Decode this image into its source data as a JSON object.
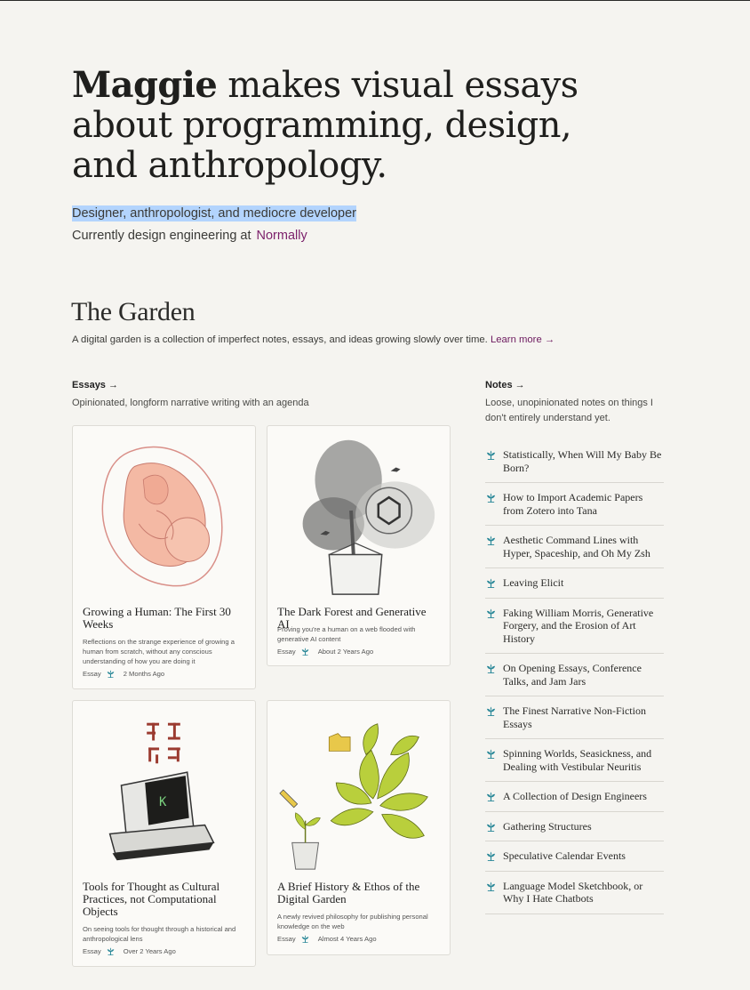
{
  "hero": {
    "name": "Maggie",
    "title_rest": " makes visual essays about programming, design, and anthropology.",
    "subtitle_highlighted": "Designer, anthropologist, and mediocre developer",
    "current_prefix": "Currently design engineering at",
    "current_link": "Normally"
  },
  "garden": {
    "title": "The Garden",
    "description": "A digital garden is a collection of imperfect notes, essays, and ideas growing slowly over time.",
    "learn_more": "Learn more →"
  },
  "essays": {
    "heading": "Essays",
    "arrow": "→",
    "description": "Opinionated, longform narrative writing with an agenda",
    "items": [
      {
        "title": "Growing a Human: The First 30 Weeks",
        "description": "Reflections on the strange experience of growing a human from scratch, without any conscious understanding of how you are doing it",
        "type": "Essay",
        "date": "2 Months Ago"
      },
      {
        "title": "The Dark Forest and Generative AI",
        "description": "Proving you're a human on a web flooded with generative AI content",
        "type": "Essay",
        "date": "About 2 Years Ago"
      },
      {
        "title": "Tools for Thought as Cultural Practices, not Computational Objects",
        "description": "On seeing tools for thought through a historical and anthropological lens",
        "type": "Essay",
        "date": "Over 2 Years Ago"
      },
      {
        "title": "A Brief History & Ethos of the Digital Garden",
        "description": "A newly revived philosophy for publishing personal knowledge on the web",
        "type": "Essay",
        "date": "Almost 4 Years Ago"
      }
    ]
  },
  "notes": {
    "heading": "Notes",
    "arrow": "→",
    "description": "Loose, unopinionated notes on things I don't entirely understand yet.",
    "items": [
      "Statistically, When Will My Baby Be Born?",
      "How to Import Academic Papers from Zotero into Tana",
      "Aesthetic Command Lines with Hyper, Spaceship, and Oh My Zsh",
      "Leaving Elicit",
      "Faking William Morris, Generative Forgery, and the Erosion of Art History",
      "On Opening Essays, Conference Talks, and Jam Jars",
      "The Finest Narrative Non-Fiction Essays",
      "Spinning Worlds, Seasickness, and Dealing with Vestibular Neuritis",
      "A Collection of Design Engineers",
      "Gathering Structures",
      "Speculative Calendar Events",
      "Language Model Sketchbook, or Why I Hate Chatbots"
    ]
  },
  "icons": {
    "growth_stage": "sprout-icon",
    "arrow": "arrow-right-icon"
  },
  "colors": {
    "background": "#f5f4f0",
    "link": "#7b1f6a",
    "sprout": "#2e8a9a",
    "highlight": "#b3d4fd"
  }
}
